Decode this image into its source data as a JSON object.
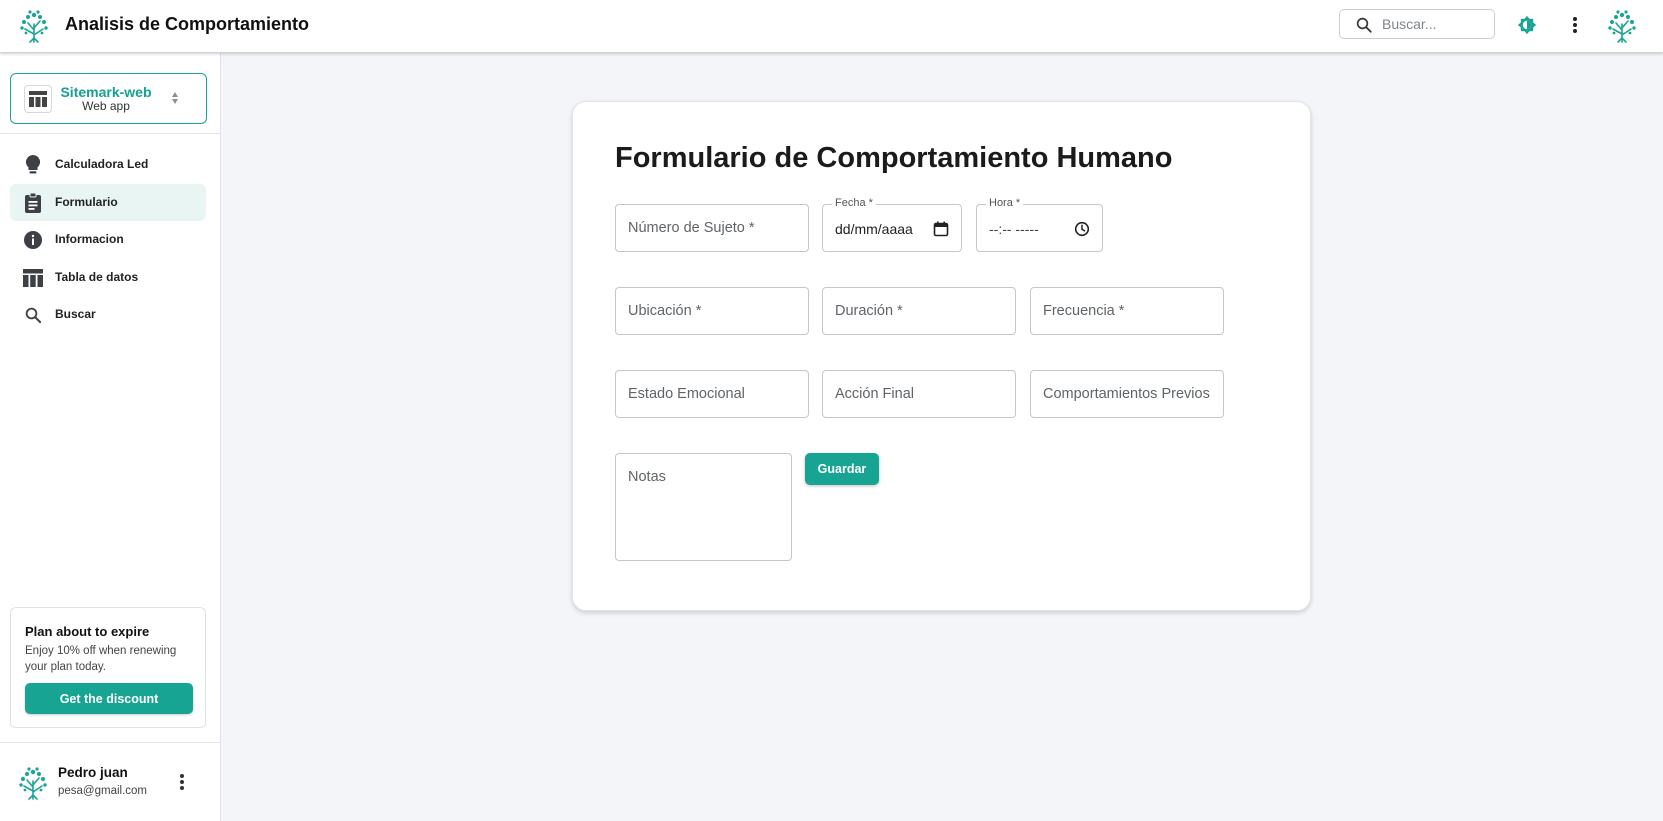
{
  "header": {
    "title": "Analisis de Comportamiento",
    "search_placeholder": "Buscar..."
  },
  "sidebar": {
    "project": {
      "name": "Sitemark-web",
      "subtitle": "Web app"
    },
    "items": [
      {
        "label": "Calculadora Led",
        "icon": "lightbulb-icon",
        "active": false
      },
      {
        "label": "Formulario",
        "icon": "clipboard-icon",
        "active": true
      },
      {
        "label": "Informacion",
        "icon": "info-icon",
        "active": false
      },
      {
        "label": "Tabla de datos",
        "icon": "table-icon",
        "active": false
      },
      {
        "label": "Buscar",
        "icon": "search-icon",
        "active": false
      }
    ],
    "plan": {
      "title": "Plan about to expire",
      "description": "Enjoy 10% off when renewing your plan today.",
      "button": "Get the discount"
    },
    "user": {
      "name": "Pedro juan",
      "email": "pesa@gmail.com"
    }
  },
  "form": {
    "title": "Formulario de Comportamiento Humano",
    "subject_placeholder": "Número de Sujeto *",
    "date_label": "Fecha *",
    "date_value": "dd/mm/aaaa",
    "time_label": "Hora *",
    "time_value": "--:-- -----",
    "location_placeholder": "Ubicación *",
    "duration_placeholder": "Duración *",
    "frequency_placeholder": "Frecuencia *",
    "emotional_placeholder": "Estado Emocional",
    "final_action_placeholder": "Acción Final",
    "previous_placeholder": "Comportamientos Previos",
    "notes_placeholder": "Notas",
    "save_label": "Guardar"
  },
  "colors": {
    "accent": "#17a493",
    "active_bg": "#e9f5f3",
    "page_bg": "#f4f5f8"
  }
}
